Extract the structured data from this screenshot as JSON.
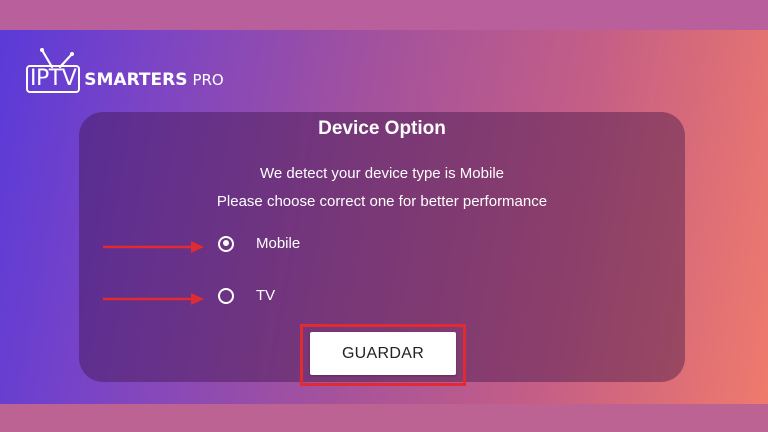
{
  "app": {
    "logo": {
      "iptv": "IPTV",
      "smarters": "SMARTERS",
      "pro": "PRO"
    }
  },
  "dialog": {
    "title": "Device Option",
    "line1": "We detect your device type is Mobile",
    "line2": "Please choose correct one for better performance",
    "options": [
      {
        "label": "Mobile",
        "selected": true
      },
      {
        "label": "TV",
        "selected": false
      }
    ],
    "save_label": "GUARDAR"
  },
  "colors": {
    "gradient_start": "#5a3ad8",
    "gradient_end": "#ef7a6c",
    "annotation_red": "#e02b33",
    "button_bg": "#ffffff"
  },
  "icons": {
    "logo_antenna": "tv-antenna-icon",
    "annotation_arrow": "arrow-right-icon"
  }
}
